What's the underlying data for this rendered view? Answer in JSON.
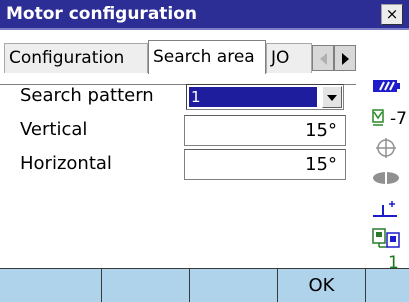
{
  "window": {
    "title": "Motor configuration",
    "close_label": "×"
  },
  "tabs": [
    {
      "label": "Configuration",
      "active": false
    },
    {
      "label": "Search area",
      "active": true
    },
    {
      "label": "JO",
      "active": false
    }
  ],
  "form": {
    "search_pattern": {
      "label": "Search pattern",
      "value": "1"
    },
    "vertical": {
      "label": "Vertical",
      "value": "15°"
    },
    "horizontal": {
      "label": "Horizontal",
      "value": "15°"
    }
  },
  "status": {
    "tilt_value": "-7",
    "counter_value": "1",
    "colors": {
      "battery": "#1d1dcc",
      "counter": "#1a7a1a",
      "edit": "#c81e1e"
    }
  },
  "softkeys": [
    "",
    "",
    "",
    "OK",
    ""
  ],
  "colors": {
    "titlebar": "#2d2d96",
    "softkey_bar": "#aed3ea",
    "selection": "#1d1d9e"
  }
}
